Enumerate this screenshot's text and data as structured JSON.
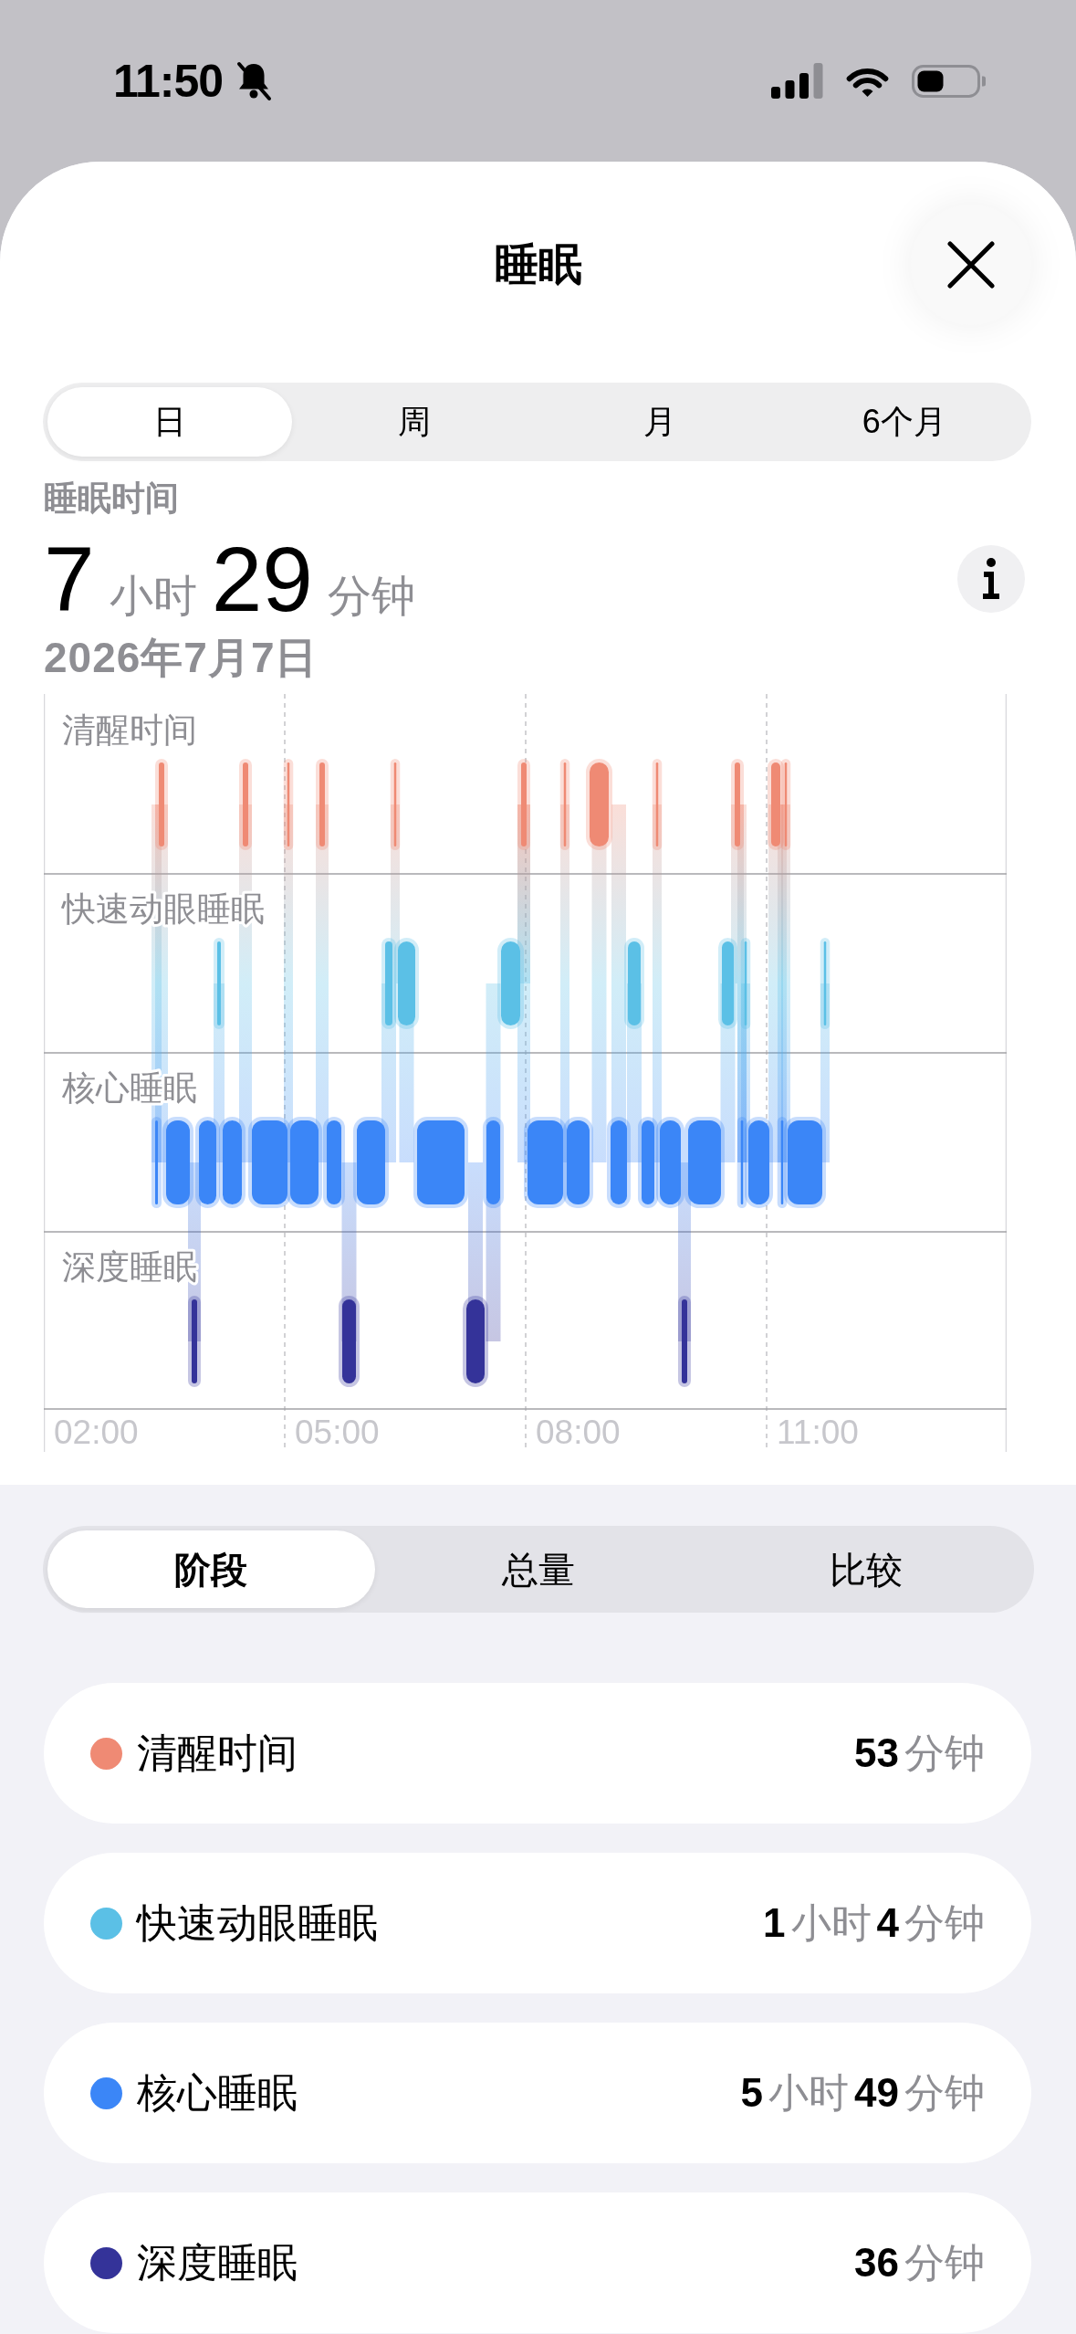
{
  "status_bar": {
    "time": "11:50"
  },
  "sheet": {
    "title": "睡眠"
  },
  "range_tabs": [
    {
      "label": "日",
      "selected": true
    },
    {
      "label": "周",
      "selected": false
    },
    {
      "label": "月",
      "selected": false
    },
    {
      "label": "6个月",
      "selected": false
    }
  ],
  "summary": {
    "label": "睡眠时间",
    "total": "**7**小时**29**分钟",
    "date": "2026年7月7日"
  },
  "sleep_chart": {
    "stage_labels": [
      "清醒时间",
      "快速动眼睡眠",
      "核心睡眠",
      "深度睡眠"
    ],
    "time_labels": [
      "02:00",
      "05:00",
      "08:00",
      "11:00"
    ]
  },
  "view_tabs": [
    {
      "label": "阶段",
      "selected": true
    },
    {
      "label": "总量",
      "selected": false
    },
    {
      "label": "比较",
      "selected": false
    }
  ],
  "stages": [
    {
      "name": "清醒时间",
      "value": "**53**分钟",
      "color": "#ef8a74"
    },
    {
      "name": "快速动眼睡眠",
      "value": "**1**小时**4**分钟",
      "color": "#5bc0e6"
    },
    {
      "name": "核心睡眠",
      "value": "**5**小时**49**分钟",
      "color": "#3b86f7"
    },
    {
      "name": "深度睡眠",
      "value": "**36**分钟",
      "color": "#343399"
    }
  ]
}
